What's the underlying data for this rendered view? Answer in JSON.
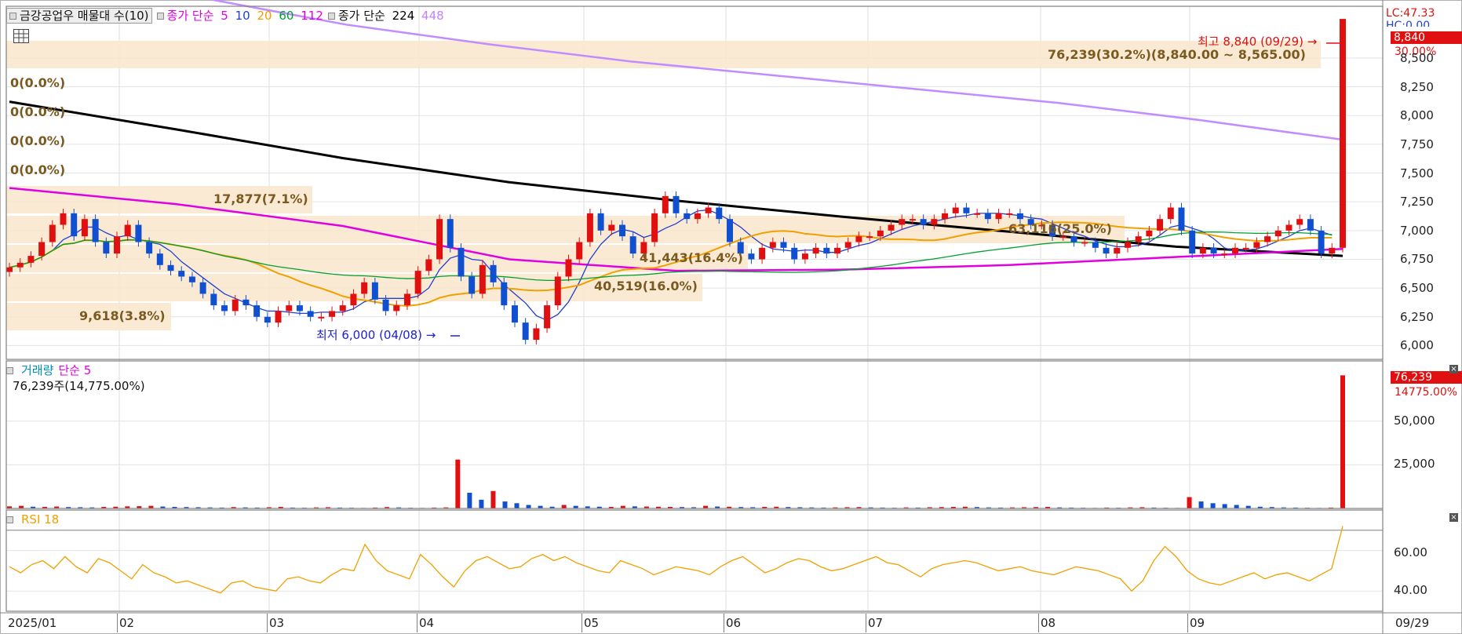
{
  "price_panel": {
    "legend_title": "금강공업우 매물대 수(10)",
    "legend_ma_prefix": "종가 단순",
    "legend_ma_periods": [
      {
        "label": "5",
        "color": "#e000e0"
      },
      {
        "label": "10",
        "color": "#2040d0"
      },
      {
        "label": "20",
        "color": "#f0a000"
      },
      {
        "label": "60",
        "color": "#00a030"
      },
      {
        "label": "112",
        "color": "#e000e0"
      }
    ],
    "legend2_prefix": "종가 단순",
    "legend2_periods": [
      {
        "label": "224",
        "color": "#000000"
      },
      {
        "label": "448",
        "color": "#c080ff"
      }
    ],
    "lc_label": "LC:47.33",
    "hc_label": "HC:0.00",
    "current_price_tag": "8,840",
    "current_pct_tag": "30.00%",
    "high_annotation": "최고 8,840 (09/29)",
    "low_annotation": "최저 6,000 (04/08)",
    "y_ticks": [
      "8,500",
      "8,250",
      "8,000",
      "7,750",
      "7,500",
      "7,250",
      "7,000",
      "6,750",
      "6,500",
      "6,250",
      "6,000"
    ],
    "volume_profile": [
      {
        "label": "76,239(30.2%)(8,840.00 ~ 8,565.00)",
        "value": 76239,
        "pct": 30.2,
        "range": [
          8565,
          8840
        ]
      },
      {
        "label": "0(0.0%)",
        "value": 0,
        "pct": 0.0
      },
      {
        "label": "0(0.0%)",
        "value": 0,
        "pct": 0.0
      },
      {
        "label": "0(0.0%)",
        "value": 0,
        "pct": 0.0
      },
      {
        "label": "0(0.0%)",
        "value": 0,
        "pct": 0.0
      },
      {
        "label": "17,877(7.1%)",
        "value": 17877,
        "pct": 7.1
      },
      {
        "label": "63,116(25.0%)",
        "value": 63116,
        "pct": 25.0
      },
      {
        "label": "41,443(16.4%)",
        "value": 41443,
        "pct": 16.4
      },
      {
        "label": "40,519(16.0%)",
        "value": 40519,
        "pct": 16.0
      },
      {
        "label": "9,618(3.8%)",
        "value": 9618,
        "pct": 3.8
      }
    ]
  },
  "volume_panel": {
    "legend_title": "거래량",
    "legend_ma": "단순 5",
    "summary": "76,239주(14,775.00%)",
    "last_volume_tag": "76,239",
    "last_pct_tag": "14775.00%",
    "y_ticks": [
      "50,000",
      "25,000"
    ]
  },
  "rsi_panel": {
    "legend_title": "RSI 18",
    "y_ticks": [
      "60.00",
      "40.00"
    ]
  },
  "x_axis": {
    "labels": [
      "2025/01",
      "02",
      "03",
      "04",
      "05",
      "06",
      "07",
      "08",
      "09"
    ],
    "end_label": "09/29"
  },
  "chart_data": [
    {
      "type": "candlestick",
      "title": "금강공업우",
      "x_range": [
        "2025/01",
        "09/29"
      ],
      "ylim": [
        5900,
        8900
      ],
      "series": [
        {
          "name": "price",
          "values": [
            6680,
            6720,
            6780,
            6900,
            7050,
            7150,
            6950,
            7100,
            6900,
            6800,
            6950,
            7050,
            6900,
            6800,
            6700,
            6650,
            6600,
            6550,
            6450,
            6350,
            6300,
            6400,
            6350,
            6250,
            6200,
            6300,
            6350,
            6300,
            6250,
            6250,
            6300,
            6350,
            6450,
            6550,
            6400,
            6300,
            6350,
            6450,
            6650,
            6750,
            7100,
            6850,
            6600,
            6450,
            6700,
            6550,
            6350,
            6200,
            6050,
            6150,
            6350,
            6600,
            6750,
            6900,
            7150,
            7000,
            7050,
            6950,
            6800,
            6900,
            7150,
            7300,
            7150,
            7100,
            7150,
            7200,
            7100,
            6900,
            6800,
            6750,
            6850,
            6900,
            6850,
            6750,
            6800,
            6850,
            6800,
            6850,
            6900,
            6950,
            6950,
            7000,
            7050,
            7100,
            7100,
            7050,
            7100,
            7150,
            7200,
            7150,
            7150,
            7100,
            7150,
            7150,
            7100,
            7050,
            7050,
            6950,
            6950,
            6900,
            6900,
            6850,
            6800,
            6850,
            6900,
            6950,
            7000,
            7100,
            7200,
            7000,
            6800,
            6850,
            6800,
            6800,
            6850,
            6850,
            6900,
            6950,
            7000,
            7050,
            7100,
            7000,
            6800,
            6850,
            8840
          ]
        },
        {
          "name": "MA 224",
          "values": [
            8120,
            7880,
            7630,
            7420,
            7260,
            7120,
            6990,
            6860,
            6780
          ]
        },
        {
          "name": "MA 448",
          "values": [
            9020,
            8790,
            8620,
            8470,
            8350,
            8230,
            8110,
            7960,
            7790
          ]
        },
        {
          "name": "MA 112",
          "values": [
            7370,
            7230,
            7040,
            6750,
            6650,
            6660,
            6700,
            6770,
            6840
          ]
        }
      ]
    },
    {
      "type": "bar",
      "title": "거래량",
      "ylim": [
        0,
        76239
      ],
      "series": [
        {
          "name": "volume",
          "values": [
            1200,
            1500,
            1000,
            900,
            1100,
            800,
            700,
            600,
            900,
            1000,
            1200,
            1300,
            1500,
            1100,
            900,
            800,
            700,
            600,
            500,
            800,
            600,
            500,
            700,
            900,
            500,
            400,
            600,
            700,
            500,
            400,
            300,
            500,
            800,
            600,
            400,
            300,
            500,
            600,
            28000,
            9000,
            5000,
            10000,
            4000,
            3000,
            2000,
            1500,
            1000,
            2000,
            1500,
            1200,
            1000,
            900,
            1500,
            1200,
            1100,
            1000,
            900,
            800,
            700,
            1500,
            1100,
            1000,
            800,
            700,
            900,
            1000,
            800,
            700,
            600,
            500,
            600,
            700,
            800,
            600,
            500,
            400,
            600,
            500,
            700,
            800,
            900,
            1000,
            800,
            600,
            500,
            600,
            700,
            800,
            900,
            600,
            500,
            400,
            300,
            500,
            400,
            600,
            700,
            500,
            400,
            300,
            6500,
            4000,
            3000,
            2500,
            2000,
            1500,
            1000,
            800,
            600,
            500,
            400,
            300,
            500,
            76239
          ]
        }
      ]
    },
    {
      "type": "line",
      "title": "RSI 18",
      "ylim": [
        32,
        75
      ],
      "series": [
        {
          "name": "RSI 18",
          "values": [
            52,
            49,
            53,
            55,
            51,
            57,
            52,
            49,
            56,
            54,
            50,
            46,
            53,
            49,
            47,
            44,
            45,
            43,
            41,
            39,
            44,
            45,
            42,
            41,
            40,
            46,
            47,
            45,
            44,
            48,
            51,
            50,
            63,
            55,
            50,
            48,
            46,
            58,
            53,
            47,
            42,
            50,
            55,
            57,
            54,
            51,
            52,
            56,
            58,
            55,
            57,
            54,
            52,
            50,
            49,
            55,
            53,
            51,
            48,
            50,
            52,
            51,
            50,
            48,
            52,
            55,
            57,
            53,
            49,
            51,
            54,
            56,
            55,
            52,
            50,
            51,
            53,
            55,
            57,
            54,
            53,
            50,
            47,
            51,
            53,
            54,
            55,
            54,
            52,
            50,
            51,
            52,
            50,
            49,
            48,
            50,
            52,
            51,
            50,
            48,
            46,
            40,
            45,
            55,
            62,
            57,
            50,
            46,
            44,
            43,
            45,
            47,
            49,
            46,
            48,
            49,
            47,
            45,
            48,
            51,
            72
          ]
        }
      ]
    }
  ]
}
